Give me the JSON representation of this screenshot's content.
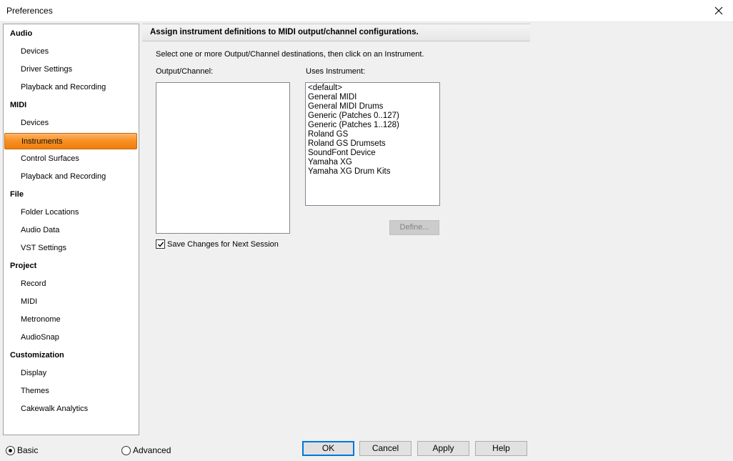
{
  "window": {
    "title": "Preferences"
  },
  "sidebar": {
    "rows": [
      {
        "label": "Audio",
        "type": "category"
      },
      {
        "label": "Devices",
        "type": "item"
      },
      {
        "label": "Driver Settings",
        "type": "item"
      },
      {
        "label": "Playback and Recording",
        "type": "item"
      },
      {
        "label": "MIDI",
        "type": "category"
      },
      {
        "label": "Devices",
        "type": "item"
      },
      {
        "label": "Instruments",
        "type": "item",
        "selected": true
      },
      {
        "label": "Control Surfaces",
        "type": "item"
      },
      {
        "label": "Playback and Recording",
        "type": "item"
      },
      {
        "label": "File",
        "type": "category"
      },
      {
        "label": "Folder Locations",
        "type": "item"
      },
      {
        "label": "Audio Data",
        "type": "item"
      },
      {
        "label": "VST Settings",
        "type": "item"
      },
      {
        "label": "Project",
        "type": "category"
      },
      {
        "label": "Record",
        "type": "item"
      },
      {
        "label": "MIDI",
        "type": "item"
      },
      {
        "label": "Metronome",
        "type": "item"
      },
      {
        "label": "AudioSnap",
        "type": "item"
      },
      {
        "label": "Customization",
        "type": "category"
      },
      {
        "label": "Display",
        "type": "item"
      },
      {
        "label": "Themes",
        "type": "item"
      },
      {
        "label": "Cakewalk Analytics",
        "type": "item"
      }
    ]
  },
  "content": {
    "header": "Assign instrument definitions to MIDI output/channel configurations.",
    "instructions": "Select one or more Output/Channel destinations, then click on an Instrument.",
    "output_label": "Output/Channel:",
    "uses_label": "Uses Instrument:",
    "instruments": [
      "<default>",
      "General MIDI",
      "General MIDI Drums",
      "Generic (Patches 0..127)",
      "Generic (Patches 1..128)",
      "Roland GS",
      "Roland GS Drumsets",
      "SoundFont Device",
      "Yamaha XG",
      "Yamaha XG Drum Kits"
    ],
    "define_label": "Define...",
    "save_changes_label": "Save Changes for Next Session",
    "save_changes_checked": true
  },
  "footer": {
    "basic_label": "Basic",
    "advanced_label": "Advanced",
    "mode_selected": "basic",
    "ok_label": "OK",
    "cancel_label": "Cancel",
    "apply_label": "Apply",
    "help_label": "Help"
  },
  "colors": {
    "selection_gradient_top": "#fdb56b",
    "selection_gradient_bottom": "#f07d0c",
    "default_button_border": "#0078d7"
  },
  "icons": {
    "close": "close-icon",
    "check": "check-icon"
  }
}
